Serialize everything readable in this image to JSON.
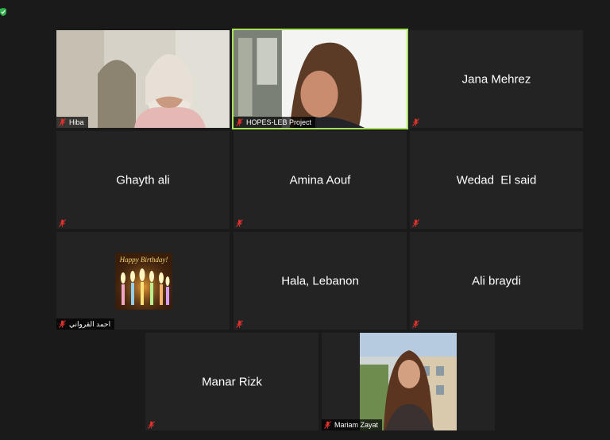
{
  "meeting": {
    "participants": [
      {
        "name": "Hiba",
        "display": "video"
      },
      {
        "name": "HOPES-LEB Project",
        "display": "video",
        "speaking": true
      },
      {
        "name": "Jana Mehrez",
        "display": "name"
      },
      {
        "name": "Ghayth ali",
        "display": "name"
      },
      {
        "name": "Amina Aouf",
        "display": "name"
      },
      {
        "name": "Wedad  El said",
        "display": "name"
      },
      {
        "name": "احمد القرواني",
        "display": "image"
      },
      {
        "name": "Hala, Lebanon",
        "display": "name"
      },
      {
        "name": "Ali braydi",
        "display": "name"
      },
      {
        "name": "Manar Rizk",
        "display": "name"
      },
      {
        "name": "Mariam Zayat",
        "display": "video"
      }
    ],
    "birthday_card_text": "Happy Birthday!",
    "colors": {
      "background": "#1a1a1a",
      "tile": "#232323",
      "active_speaker_border": "#a7e05a",
      "muted_icon": "#e0312b",
      "security_badge": "#2fb24c"
    },
    "icons": {
      "muted": "microphone-muted-icon",
      "security": "shield-check-icon"
    }
  }
}
